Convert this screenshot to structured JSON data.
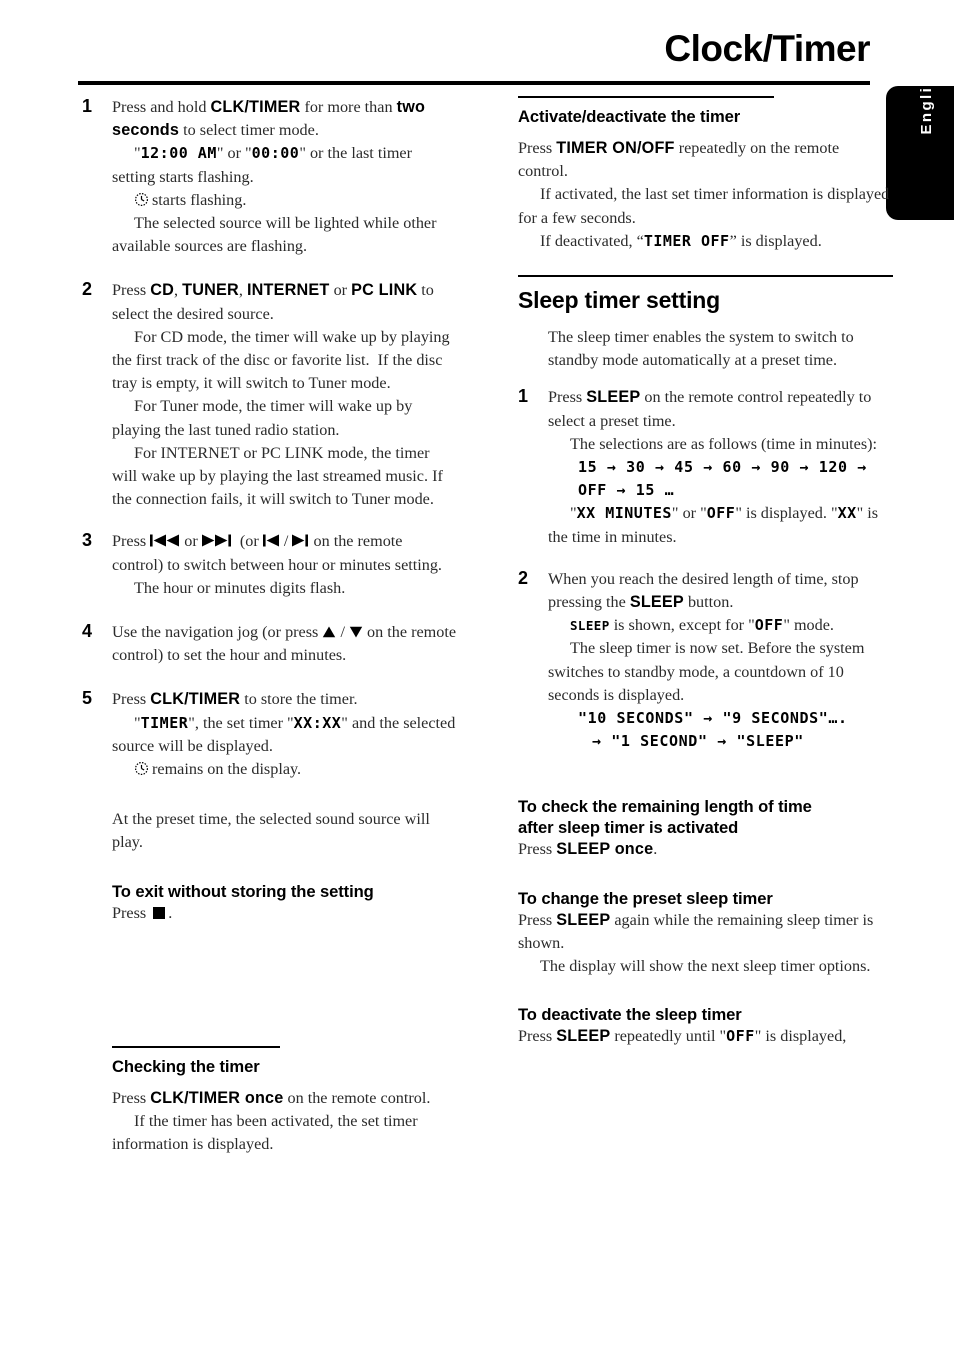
{
  "header": {
    "title": "Clock/Timer",
    "language_tab": "English"
  },
  "left_column": {
    "steps": [
      {
        "num": "1",
        "lines": [
          {
            "kind": "rich",
            "segments": [
              {
                "t": "Press and hold ",
                "s": "normal"
              },
              {
                "t": "CLK/TIMER",
                "s": "bold"
              },
              {
                "t": " for more than ",
                "s": "normal"
              },
              {
                "t": "two seconds",
                "s": "bold"
              },
              {
                "t": " to select timer mode.",
                "s": "normal"
              }
            ]
          },
          {
            "kind": "rich",
            "indent": true,
            "segments": [
              {
                "t": "\"",
                "s": "normal"
              },
              {
                "t": "12:00 AM",
                "s": "lcd"
              },
              {
                "t": "\" or \"",
                "s": "normal"
              },
              {
                "t": "00:00",
                "s": "lcd"
              },
              {
                "t": "\" or the last timer setting starts flashing.",
                "s": "normal"
              }
            ]
          },
          {
            "kind": "rich",
            "indent": true,
            "icon": "clock",
            "segments": [
              {
                "t": " starts flashing.",
                "s": "normal"
              }
            ]
          },
          {
            "kind": "rich",
            "indent": true,
            "segments": [
              {
                "t": "The selected source will be lighted while other available sources are flashing.",
                "s": "normal"
              }
            ]
          }
        ]
      },
      {
        "num": "2",
        "lines": [
          {
            "kind": "rich",
            "segments": [
              {
                "t": "Press ",
                "s": "normal"
              },
              {
                "t": "CD",
                "s": "bold"
              },
              {
                "t": ", ",
                "s": "normal"
              },
              {
                "t": "TUNER",
                "s": "bold"
              },
              {
                "t": ", ",
                "s": "normal"
              },
              {
                "t": "INTERNET",
                "s": "bold"
              },
              {
                "t": " or ",
                "s": "normal"
              },
              {
                "t": "PC LINK",
                "s": "bold"
              },
              {
                "t": " to select the desired source.",
                "s": "normal"
              }
            ]
          },
          {
            "kind": "rich",
            "indent": true,
            "segments": [
              {
                "t": "For CD mode, the timer will wake up by playing the first track of the disc or favorite list.  If the disc tray is empty, it will switch to Tuner mode.",
                "s": "normal"
              }
            ]
          },
          {
            "kind": "rich",
            "indent": true,
            "segments": [
              {
                "t": "For Tuner mode, the timer will wake up by playing the last tuned radio station.",
                "s": "normal"
              }
            ]
          },
          {
            "kind": "rich",
            "indent": true,
            "segments": [
              {
                "t": "For INTERNET or PC LINK mode, the timer will wake up by playing the last streamed music. If the connection fails, it will switch to Tuner mode.",
                "s": "normal"
              }
            ]
          }
        ]
      },
      {
        "num": "3",
        "lines": [
          {
            "kind": "rich",
            "segments": [
              {
                "t": "Press ",
                "s": "normal"
              },
              {
                "t": "prev-track-icon",
                "s": "glyph"
              },
              {
                "t": " or ",
                "s": "normal"
              },
              {
                "t": "next-track-icon",
                "s": "glyph"
              },
              {
                "t": "  (or ",
                "s": "normal"
              },
              {
                "t": "prev-icon",
                "s": "glyph"
              },
              {
                "t": " / ",
                "s": "normal"
              },
              {
                "t": "next-icon",
                "s": "glyph"
              },
              {
                "t": " on the remote control) to switch between hour or minutes setting.",
                "s": "normal"
              }
            ]
          },
          {
            "kind": "rich",
            "indent": true,
            "segments": [
              {
                "t": "The hour or minutes digits flash.",
                "s": "normal"
              }
            ]
          }
        ]
      },
      {
        "num": "4",
        "lines": [
          {
            "kind": "rich",
            "segments": [
              {
                "t": "Use the navigation jog (or press ",
                "s": "normal"
              },
              {
                "t": "up-icon",
                "s": "glyph"
              },
              {
                "t": " / ",
                "s": "normal"
              },
              {
                "t": "down-icon",
                "s": "glyph"
              },
              {
                "t": " on the remote control) to set the hour and minutes.",
                "s": "normal"
              }
            ]
          }
        ]
      },
      {
        "num": "5",
        "lines": [
          {
            "kind": "rich",
            "segments": [
              {
                "t": "Press ",
                "s": "normal"
              },
              {
                "t": "CLK/TIMER",
                "s": "bold"
              },
              {
                "t": " to store the timer.",
                "s": "normal"
              }
            ]
          },
          {
            "kind": "rich",
            "indent": true,
            "segments": [
              {
                "t": "\"",
                "s": "normal"
              },
              {
                "t": "TIMER",
                "s": "lcd"
              },
              {
                "t": "\", the set timer \"",
                "s": "normal"
              },
              {
                "t": "XX:XX",
                "s": "lcd"
              },
              {
                "t": "\" and the selected source will be displayed.",
                "s": "normal"
              }
            ]
          },
          {
            "kind": "rich",
            "indent": true,
            "icon": "clock",
            "segments": [
              {
                "t": " remains on the display.",
                "s": "normal"
              }
            ]
          }
        ]
      }
    ],
    "after_steps": "At the preset time, the selected sound source will play.",
    "exit_heading": "To exit without storing the setting",
    "exit_press_prefix": "Press ",
    "exit_press_suffix": ".",
    "checking": {
      "heading": "Checking the timer",
      "line1_pre": "Press ",
      "line1_bold": "CLK/TIMER once",
      "line1_post": " on the remote control.",
      "line2": "If the timer has been activated, the set timer information is displayed."
    }
  },
  "right_column": {
    "activate": {
      "heading": "Activate/deactivate the timer",
      "line1_pre": "Press ",
      "line1_bold": "TIMER ON/OFF",
      "line1_post": " repeatedly on the remote control.",
      "line2": "If activated, the last set timer information is displayed for a few seconds.",
      "line3_pre": "If deactivated, “",
      "line3_lcd": "TIMER OFF",
      "line3_post": "” is displayed."
    },
    "sleep": {
      "heading": "Sleep timer setting",
      "intro": "The sleep timer enables the system to switch to standby mode automatically at a preset time.",
      "steps": [
        {
          "num": "1",
          "line1_pre": "Press ",
          "line1_bold": "SLEEP",
          "line1_post": " on the remote control repeatedly to select a preset time.",
          "line2": "The selections are as follows (time in minutes):",
          "lcd_line1": "15 → 30 → 45 → 60 → 90 → 120 →",
          "lcd_line2": "OFF → 15 …",
          "line3_a": "\"",
          "line3_lcd1": "XX MINUTES",
          "line3_b": "\" or \"",
          "line3_lcd2": "OFF",
          "line3_c": "\" is displayed. \"",
          "line3_lcd3": "XX",
          "line3_d": "\" is the time in minutes."
        },
        {
          "num": "2",
          "line1_pre": "When you reach the desired length of time, stop pressing the ",
          "line1_bold": "SLEEP",
          "line1_post": " button.",
          "line2_lcd": "SLEEP",
          "line2_mid": " is shown, except for \"",
          "line2_lcd2": "OFF",
          "line2_post": "\" mode.",
          "line3": "The sleep timer is now set. Before the system switches to standby mode, a countdown of 10 seconds is displayed.",
          "lcd_line1": "\"10 SECONDS\" → \"9 SECONDS\"….",
          "lcd_line2": "→ \"1 SECOND\" → \"SLEEP\""
        }
      ]
    },
    "check_remaining": {
      "heading_line1": "To check the remaining length of time",
      "heading_line2": "after sleep timer is activated",
      "line_pre": "Press ",
      "line_bold": "SLEEP once",
      "line_post": "."
    },
    "change_preset": {
      "heading": "To change the preset sleep timer",
      "line1_pre": "Press ",
      "line1_bold": "SLEEP",
      "line1_post": " again while the remaining sleep timer is shown.",
      "line2": "The display will show the next sleep timer options."
    },
    "deactivate": {
      "heading": " To deactivate the sleep timer",
      "line1_pre": "Press ",
      "line1_bold": "SLEEP",
      "line1_mid": " repeatedly until \"",
      "line1_lcd": "OFF",
      "line1_post": "\" is displayed,"
    }
  }
}
